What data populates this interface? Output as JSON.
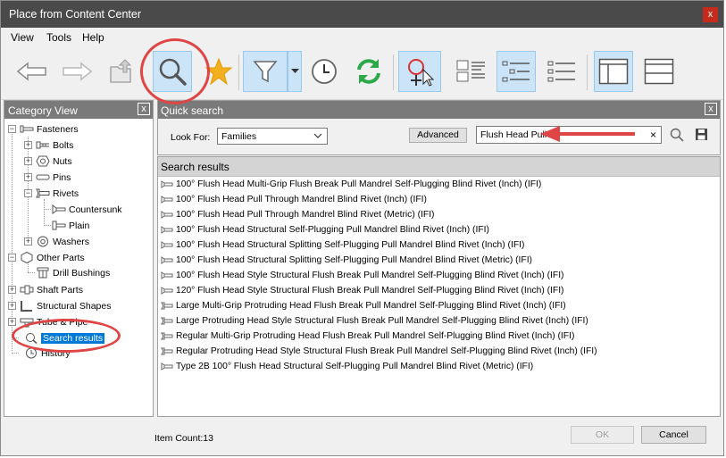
{
  "window": {
    "title": "Place from Content Center",
    "close_glyph": "x"
  },
  "menu": [
    "View",
    "Tools",
    "Help"
  ],
  "toolbar": {
    "icons": [
      "back-arrow-icon",
      "forward-arrow-icon",
      "up-folder-icon",
      "search-icon",
      "favorites-star-icon",
      "filter-icon",
      "history-clock-icon",
      "refresh-icon",
      "place-component-icon",
      "list-view-icon",
      "tree-view-icon",
      "detail-view-icon",
      "split-vertical-icon",
      "split-horizontal-icon"
    ]
  },
  "category_view": {
    "title": "Category View",
    "close_glyph": "x",
    "tree": [
      {
        "label": "Fasteners",
        "expand": "−"
      },
      {
        "label": "Bolts",
        "expand": "+"
      },
      {
        "label": "Nuts",
        "expand": "+"
      },
      {
        "label": "Pins",
        "expand": "+"
      },
      {
        "label": "Rivets",
        "expand": "−"
      },
      {
        "label": "Countersunk"
      },
      {
        "label": "Plain"
      },
      {
        "label": "Washers",
        "expand": "+"
      },
      {
        "label": "Other Parts",
        "expand": "−"
      },
      {
        "label": "Drill Bushings"
      },
      {
        "label": "Shaft Parts",
        "expand": "+"
      },
      {
        "label": "Structural Shapes",
        "expand": "+"
      },
      {
        "label": "Tube & Pipe",
        "expand": "+"
      },
      {
        "label": "Search results"
      },
      {
        "label": "History"
      }
    ]
  },
  "quick_search": {
    "title": "Quick search",
    "close_glyph": "x",
    "look_for_label": "Look For:",
    "look_for_value": "Families",
    "advanced_label": "Advanced",
    "search_value": "Flush Head Pull",
    "clear_glyph": "×"
  },
  "results": {
    "title": "Search results",
    "items": [
      "100° Flush Head Multi-Grip Flush Break Pull Mandrel Self-Plugging Blind Rivet (Inch) (IFI)",
      "100° Flush Head Pull Through Mandrel Blind Rivet (Inch) (IFI)",
      "100° Flush Head Pull Through Mandrel Blind Rivet (Metric) (IFI)",
      "100° Flush Head Structural Self-Plugging Pull Mandrel Blind Rivet (Inch) (IFI)",
      "100° Flush Head Structural Splitting Self-Plugging Pull Mandrel Blind Rivet (Inch) (IFI)",
      "100° Flush Head Structural Splitting Self-Plugging Pull Mandrel Blind Rivet (Metric) (IFI)",
      "100° Flush Head Style Structural Flush Break Pull Mandrel Self-Plugging Blind Rivet (Inch) (IFI)",
      "120° Flush Head Style Structural Flush Break Pull Mandrel Self-Plugging Blind Rivet (Inch) (IFI)",
      "Large Multi-Grip Protruding Head Flush Break Pull Mandrel Self-Plugging Blind Rivet (Inch) (IFI)",
      "Large Protruding Head Style Structural Flush Break Pull Mandrel Self-Plugging Blind Rivet (Inch) (IFI)",
      "Regular Multi-Grip Protruding Head Flush Break Pull Mandrel Self-Plugging Blind Rivet (Inch) (IFI)",
      "Regular Protruding Head Style Structural Flush Break Pull Mandrel Self-Plugging Blind Rivet (Inch) (IFI)",
      "Type 2B 100° Flush Head Structural Self-Plugging Pull Mandrel Blind Rivet (Metric) (IFI)"
    ]
  },
  "footer": {
    "item_count": "Item Count:13",
    "ok_label": "OK",
    "cancel_label": "Cancel"
  },
  "colors": {
    "titlebar": "#4a4a4a",
    "selection": "#0078d7",
    "toggle_bg": "#cce4f7",
    "annotation": "#e04545"
  }
}
